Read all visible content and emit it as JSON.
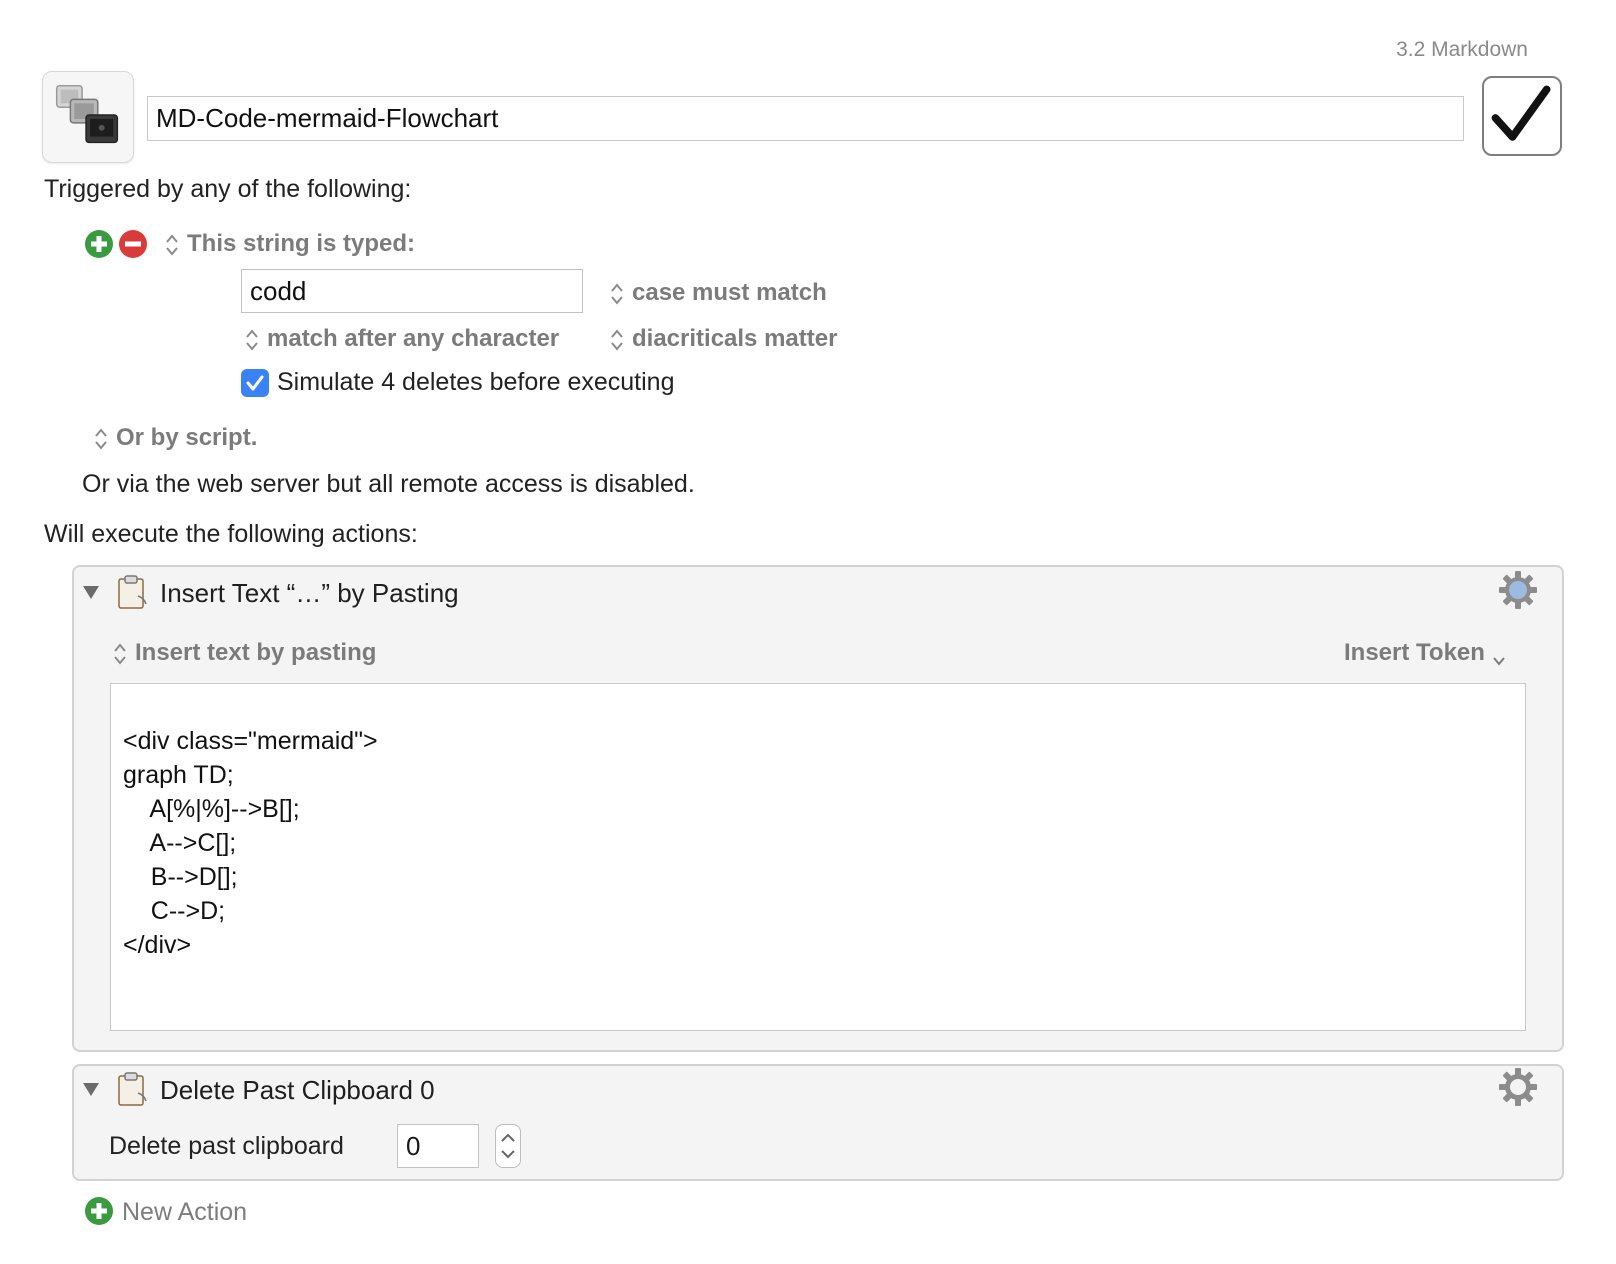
{
  "header": {
    "group_name": "3.2 Markdown",
    "macro_name": "MD-Code-mermaid-Flowchart",
    "enabled": true
  },
  "triggers": {
    "heading": "Triggered by any of the following:",
    "typed_string": {
      "type_label": "This string is typed:",
      "value": "codd",
      "case_option": "case must match",
      "match_option": "match after any character",
      "diacritics_option": "diacriticals matter",
      "simulate_label": "Simulate 4 deletes before executing",
      "simulate_checked": true
    },
    "script_label": "Or by script.",
    "web_server_text": "Or via the web server but all remote access is disabled."
  },
  "actions": {
    "heading": "Will execute the following actions:",
    "items": [
      {
        "title": "Insert Text “…” by Pasting",
        "mode_label": "Insert text by pasting",
        "insert_token_label": "Insert Token",
        "text": "<div class=\"mermaid\">\ngraph TD;\n    A[%|%]-->B[];\n    A-->C[];\n    B-->D[];\n    C-->D;\n</div>"
      },
      {
        "title": "Delete Past Clipboard 0",
        "field_label": "Delete past clipboard",
        "field_value": "0"
      }
    ],
    "new_action_label": "New Action"
  },
  "colors": {
    "add_green": "#3a9a3f",
    "remove_red": "#d93a3a",
    "checkbox_blue": "#3b82f6",
    "gear_active": "#9bbbe0",
    "gear_default": "#8c8c8c"
  },
  "icons": {
    "macro_icon": "stacked-windows-icon",
    "enable": "checkmark-icon",
    "add": "plus-circle-icon",
    "remove": "minus-circle-icon",
    "disclosure": "disclosure-triangle-icon",
    "clipboard": "clipboard-icon",
    "gear": "gear-icon"
  }
}
